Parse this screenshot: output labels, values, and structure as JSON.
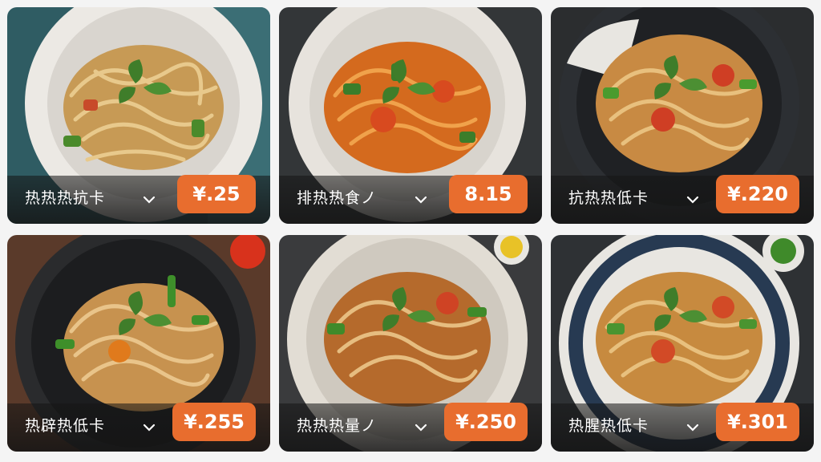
{
  "cards": [
    {
      "title": "热热热抗卡",
      "price": "¥.25",
      "bg": "#2f5c63",
      "plate": "#d9d5cf",
      "rim": "#ece9e4",
      "sauce": "#c79a55",
      "pepper": "#4a8a2b",
      "tomato": "#c84a2a"
    },
    {
      "title": "排热热食ノ",
      "price": "8.15",
      "bg": "#333638",
      "plate": "#d8d4cd",
      "rim": "#e7e3dd",
      "sauce": "#d46a1e",
      "pepper": "#3b7d2a",
      "tomato": "#d84a1f"
    },
    {
      "title": "抗热热低卡",
      "price": "¥.220",
      "bg": "#2b2d2f",
      "plate": "#1f2124",
      "rim": "#2c2f33",
      "sauce": "#c88a43",
      "pepper": "#4a9b2e",
      "tomato": "#cf3e24"
    },
    {
      "title": "热辟热低卡",
      "price": "¥.255",
      "bg": "#5a3a2a",
      "plate": "#1c1d1f",
      "rim": "#2a2b2d",
      "sauce": "#c7924f",
      "pepper": "#3e8f2a",
      "tomato": "#e07a1c"
    },
    {
      "title": "热热热量ノ",
      "price": "¥.250",
      "bg": "#3a3b3d",
      "plate": "#cfc9bf",
      "rim": "#e2ddd4",
      "sauce": "#b56a2c",
      "pepper": "#3f8a2a",
      "tomato": "#cf4324"
    },
    {
      "title": "热腥热低卡",
      "price": "¥.301",
      "bg": "#2e3134",
      "plate": "#273a52",
      "rim": "#e8e6e1",
      "sauce": "#c78a3f",
      "pepper": "#4a9430",
      "tomato": "#d24a26"
    }
  ],
  "icons": {
    "dropdown": "chevron-down-icon",
    "basil": "basil-leaf-icon"
  }
}
